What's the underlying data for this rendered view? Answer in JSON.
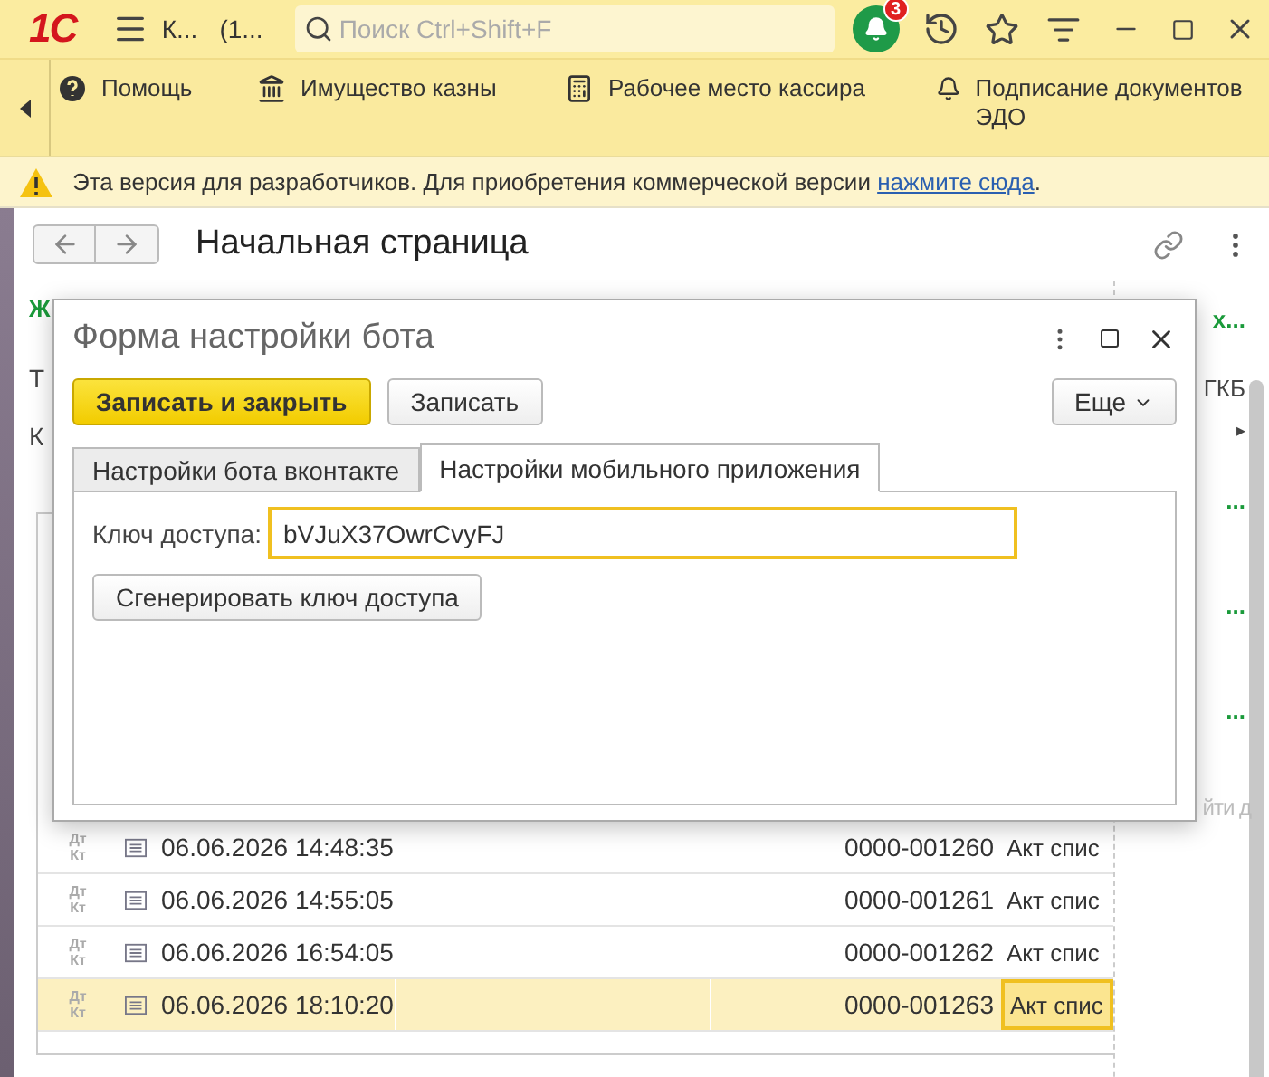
{
  "app": {
    "logo": "1С",
    "title_parts": [
      "К...",
      "(1..."
    ],
    "search": {
      "placeholder": "Поиск Ctrl+Shift+F"
    },
    "notifications": {
      "count": "3"
    }
  },
  "nav_panel": {
    "items": [
      {
        "label": "Помощь"
      },
      {
        "label": "Имущество казны"
      },
      {
        "label": "Рабочее место кассира"
      },
      {
        "label": "Подписание документов ЭДО"
      }
    ]
  },
  "warning": {
    "text": "Эта версия для разработчиков. Для приобретения коммерческой версии ",
    "link": "нажмите сюда",
    "end": "."
  },
  "page": {
    "title": "Начальная страница",
    "left_fragments": [
      {
        "text": "Ж",
        "kind": "heading"
      },
      {
        "text": "Т",
        "kind": "plain"
      },
      {
        "text": "К",
        "kind": "plain"
      }
    ],
    "right_fragments": [
      {
        "text": "х...",
        "kind": "heading"
      },
      {
        "text": "ГКБ",
        "kind": "plain"
      },
      {
        "text": "▸",
        "kind": "arrow"
      },
      {
        "text": "...",
        "kind": "dots"
      },
      {
        "text": "...",
        "kind": "dots"
      },
      {
        "text": "...",
        "kind": "dots"
      },
      {
        "text": "йти д",
        "kind": "search"
      }
    ],
    "rows": [
      {
        "mark_top": "Дт",
        "mark_bottom": "Кт",
        "date": "06.06.2026 14:48:35",
        "number": "0000-001260",
        "doc": "Акт спис",
        "selected": false
      },
      {
        "mark_top": "Дт",
        "mark_bottom": "Кт",
        "date": "06.06.2026 14:55:05",
        "number": "0000-001261",
        "doc": "Акт спис",
        "selected": false
      },
      {
        "mark_top": "Дт",
        "mark_bottom": "Кт",
        "date": "06.06.2026 16:54:05",
        "number": "0000-001262",
        "doc": "Акт спис",
        "selected": false
      },
      {
        "mark_top": "Дт",
        "mark_bottom": "Кт",
        "date": "06.06.2026 18:10:20",
        "number": "0000-001263",
        "doc": "Акт спис",
        "selected": true
      }
    ]
  },
  "dialog": {
    "title": "Форма настройки бота",
    "buttons": [
      {
        "label": "Записать и закрыть",
        "kind": "primary"
      },
      {
        "label": "Записать",
        "kind": "default"
      }
    ],
    "more": "Еще",
    "tabs": [
      {
        "label": "Настройки бота вконтакте",
        "selected": false
      },
      {
        "label": "Настройки мобильного приложения",
        "selected": true
      }
    ],
    "field": {
      "label": "Ключ доступа:",
      "value": "bVJuX37OwrCvyFJ"
    },
    "generate_button": "Сгенерировать ключ доступа"
  }
}
